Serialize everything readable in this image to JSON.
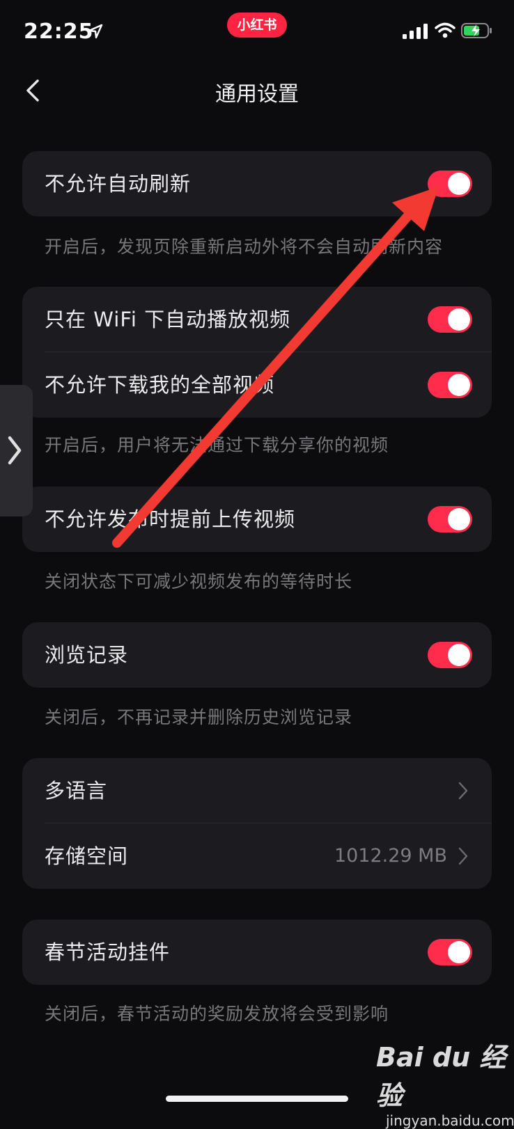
{
  "status_bar": {
    "time": "22:25",
    "brand": "小红书"
  },
  "nav": {
    "title": "通用设置"
  },
  "sections": [
    {
      "rows": [
        {
          "label": "不允许自动刷新",
          "toggle": "on"
        }
      ],
      "description": "开启后，发现页除重新启动外将不会自动刷新内容"
    },
    {
      "rows": [
        {
          "label": "只在 WiFi 下自动播放视频",
          "toggle": "on"
        },
        {
          "label": "不允许下载我的全部视频",
          "toggle": "on"
        }
      ],
      "description": "开启后，用户将无法通过下载分享你的视频"
    },
    {
      "rows": [
        {
          "label": "不允许发布时提前上传视频",
          "toggle": "on"
        }
      ],
      "description": "关闭状态下可减少视频发布的等待时长"
    },
    {
      "rows": [
        {
          "label": "浏览记录",
          "toggle": "on"
        }
      ],
      "description": "关闭后，不再记录并删除历史浏览记录"
    },
    {
      "rows": [
        {
          "label": "多语言",
          "value": ""
        },
        {
          "label": "存储空间",
          "value": "1012.29 MB"
        }
      ]
    },
    {
      "rows": [
        {
          "label": "春节活动挂件",
          "toggle": "on"
        }
      ],
      "description": "关闭后，春节活动的奖励发放将会受到影响"
    }
  ],
  "watermark": {
    "logo_text": "Bai du 经验",
    "url": "jingyan.baidu.com"
  },
  "colors": {
    "accent": "#ff2d4b",
    "background": "#0c0c0e",
    "card": "#1c1c20",
    "annotation_arrow": "#f23a33"
  }
}
